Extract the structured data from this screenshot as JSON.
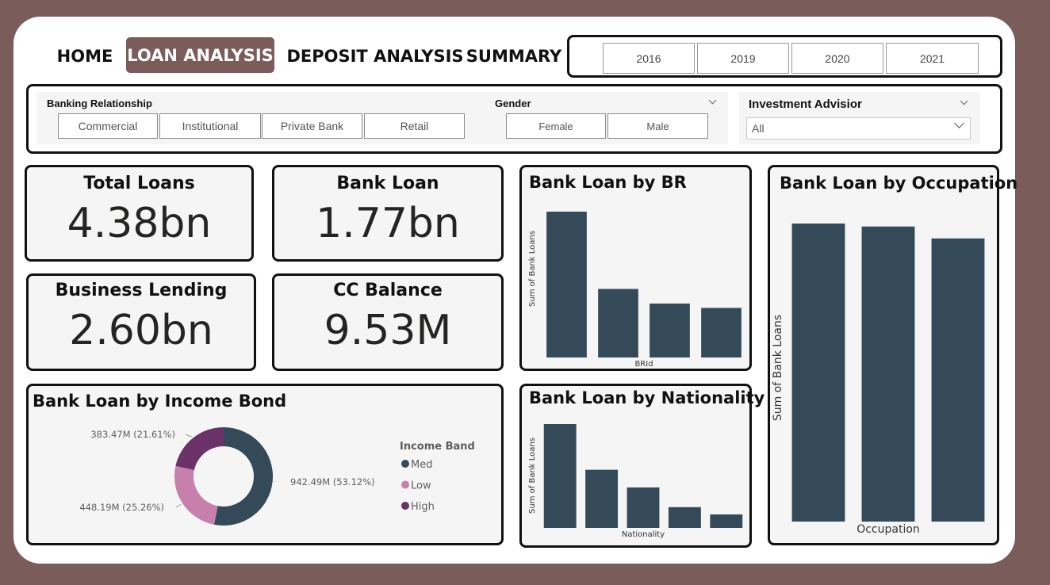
{
  "nav": {
    "home": "HOME",
    "loan_analysis": "LOAN ANALYSIS",
    "deposit_analysis": "DEPOSIT ANALYSIS",
    "summary": "SUMMARY",
    "active_color": "#7a5c5a"
  },
  "years": [
    "2016",
    "2019",
    "2020",
    "2021"
  ],
  "filters": {
    "banking_relationship": {
      "label": "Banking Relationship",
      "options": [
        "Commercial",
        "Institutional",
        "Private Bank",
        "Retail"
      ]
    },
    "gender": {
      "label": "Gender",
      "options": [
        "Female",
        "Male"
      ]
    },
    "investment_advisor": {
      "label": "Investment Advisior",
      "selected": "All"
    }
  },
  "kpis": {
    "total_loans": {
      "label": "Total Loans",
      "value": "4.38bn"
    },
    "bank_loan": {
      "label": "Bank Loan",
      "value": "1.77bn"
    },
    "business_lending": {
      "label": "Business Lending",
      "value": "2.60bn"
    },
    "cc_balance": {
      "label": "CC Balance",
      "value": "9.53M"
    }
  },
  "chart_data": [
    {
      "id": "br",
      "type": "bar",
      "title": "Bank Loan by BR",
      "xlabel": "BRId",
      "ylabel": "Sum of Bank Loans",
      "color": "#344a59",
      "values": [
        100,
        47,
        37,
        34
      ]
    },
    {
      "id": "occupation",
      "type": "bar",
      "title": "Bank Loan by Occupation",
      "xlabel": "Occupation",
      "ylabel": "Sum of Bank Loans",
      "color": "#344a59",
      "values": [
        100,
        99,
        95
      ]
    },
    {
      "id": "nationality",
      "type": "bar",
      "title": "Bank Loan by Nationality",
      "xlabel": "Nationality",
      "ylabel": "Sum of Bank Loans",
      "color": "#344a59",
      "values": [
        100,
        56,
        39,
        20,
        13
      ]
    },
    {
      "id": "income",
      "type": "pie",
      "title": "Bank Loan by Income Bond",
      "legend_title": "Income Band",
      "slices": [
        {
          "name": "Med",
          "value": 942.49,
          "label": "942.49M (53.12%)",
          "color": "#344a59"
        },
        {
          "name": "Low",
          "value": 448.19,
          "label": "448.19M (25.26%)",
          "color": "#c77fac"
        },
        {
          "name": "High",
          "value": 383.47,
          "label": "383.47M (21.61%)",
          "color": "#6a3268"
        }
      ]
    }
  ]
}
